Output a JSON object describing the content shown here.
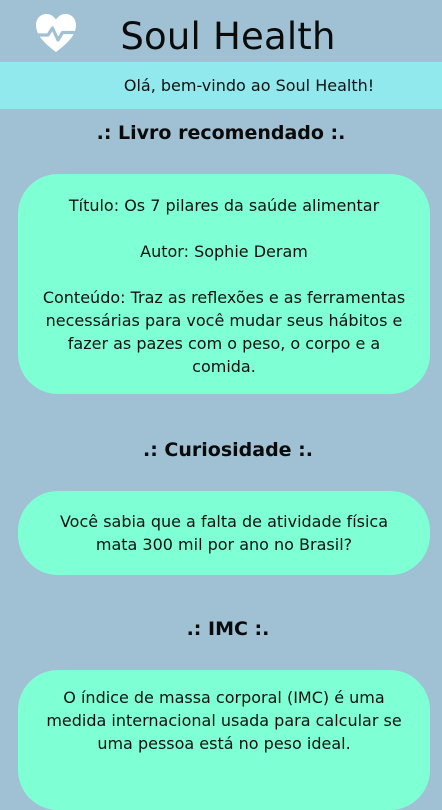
{
  "header": {
    "title": "Soul Health",
    "logo_icon": "heart-pulse-icon"
  },
  "welcome": {
    "text": "Olá, bem-vindo ao Soul Health!"
  },
  "book": {
    "section_title": ".: Livro recomendado :.",
    "title_line": "Título: Os 7 pilares da saúde alimentar",
    "author_line": "Autor: Sophie Deram",
    "content_line": "Conteúdo: Traz as reflexões e as ferramentas necessárias para você mudar seus hábitos e fazer as pazes com o peso, o corpo e a comida."
  },
  "curiosity": {
    "section_title": ".: Curiosidade :.",
    "text": "Você sabia que a falta de atividade física mata 300 mil por ano no Brasil?"
  },
  "imc": {
    "section_title": ".: IMC :.",
    "text": "O índice de massa corporal (IMC) é uma medida internacional usada para calcular se uma pessoa está no peso ideal."
  },
  "colors": {
    "background": "#9fc1d3",
    "welcome_bar": "#91e8ed",
    "card": "#7fffd4"
  }
}
